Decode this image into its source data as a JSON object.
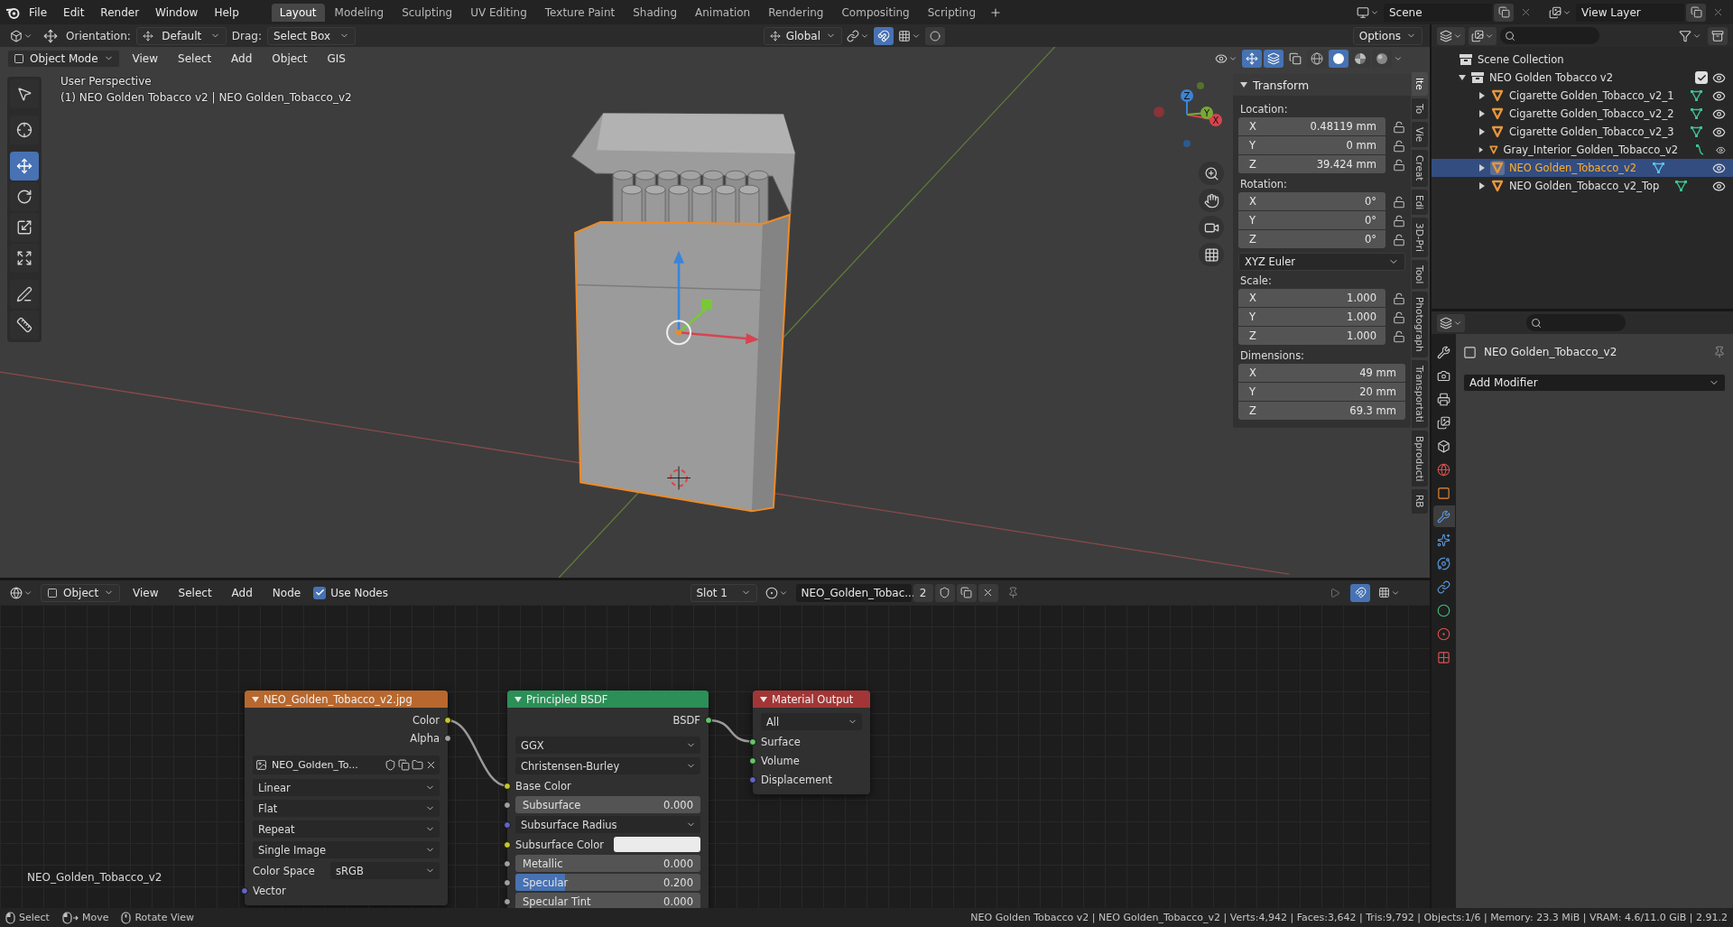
{
  "menu": [
    "File",
    "Edit",
    "Render",
    "Window",
    "Help"
  ],
  "workspaces": [
    {
      "label": "Layout",
      "selected": true
    },
    {
      "label": "Modeling",
      "selected": false
    },
    {
      "label": "Sculpting",
      "selected": false
    },
    {
      "label": "UV Editing",
      "selected": false
    },
    {
      "label": "Texture Paint",
      "selected": false
    },
    {
      "label": "Shading",
      "selected": false
    },
    {
      "label": "Animation",
      "selected": false
    },
    {
      "label": "Rendering",
      "selected": false
    },
    {
      "label": "Compositing",
      "selected": false
    },
    {
      "label": "Scripting",
      "selected": false
    }
  ],
  "scene": "Scene",
  "view_layer": "View Layer",
  "viewport": {
    "header": {
      "orientation_label": "Orientation:",
      "orientation": "Default",
      "drag_label": "Drag:",
      "drag": "Select Box",
      "transform_orientation": "Global",
      "options": "Options"
    },
    "mode": "Object Mode",
    "menus": [
      "View",
      "Select",
      "Add",
      "Object",
      "GIS"
    ],
    "shading": [
      {
        "kind": "wireframe",
        "selected": false
      },
      {
        "kind": "solid",
        "selected": true
      },
      {
        "kind": "material",
        "selected": false
      },
      {
        "kind": "rendered",
        "selected": false
      }
    ],
    "info": [
      "User Perspective",
      "(1) NEO Golden Tobacco v2 | NEO Golden_Tobacco_v2"
    ],
    "tools": [
      {
        "kind": "select",
        "selected": false
      },
      {
        "kind": "cursor",
        "selected": false
      },
      {
        "kind": "move",
        "selected": true
      },
      {
        "kind": "rotate",
        "selected": false
      },
      {
        "kind": "scale",
        "selected": false
      },
      {
        "kind": "transform",
        "selected": false
      },
      {
        "kind": "annotate",
        "selected": false
      },
      {
        "kind": "measure",
        "selected": false
      }
    ],
    "gizmo_axes": [
      {
        "label": "X",
        "color": "#d8434f"
      },
      {
        "label": "Y",
        "color": "#79a937"
      },
      {
        "label": "Z",
        "color": "#3a84d8"
      }
    ],
    "sidebar_tabs": [
      {
        "label": "Ite",
        "selected": true
      },
      {
        "label": "To",
        "selected": false
      },
      {
        "label": "Vie",
        "selected": false
      },
      {
        "label": "Creat",
        "selected": false
      },
      {
        "label": "Edi",
        "selected": false
      },
      {
        "label": "3D-Pri",
        "selected": false
      },
      {
        "label": "Tool",
        "selected": false
      },
      {
        "label": "Photograph",
        "selected": false
      },
      {
        "label": "Transportati",
        "selected": false
      },
      {
        "label": "Bproducti",
        "selected": false
      },
      {
        "label": "RB",
        "selected": false
      }
    ],
    "transform": {
      "title": "Transform",
      "groups": [
        {
          "label": "Location:",
          "locks": true,
          "fields": [
            {
              "axis": "X",
              "value": "0.48119 mm"
            },
            {
              "axis": "Y",
              "value": "0 mm"
            },
            {
              "axis": "Z",
              "value": "39.424 mm"
            }
          ]
        },
        {
          "label": "Rotation:",
          "locks": true,
          "fields": [
            {
              "axis": "X",
              "value": "0°"
            },
            {
              "axis": "Y",
              "value": "0°"
            },
            {
              "axis": "Z",
              "value": "0°"
            }
          ],
          "mode": "XYZ Euler"
        },
        {
          "label": "Scale:",
          "locks": true,
          "fields": [
            {
              "axis": "X",
              "value": "1.000"
            },
            {
              "axis": "Y",
              "value": "1.000"
            },
            {
              "axis": "Z",
              "value": "1.000"
            }
          ]
        },
        {
          "label": "Dimensions:",
          "locks": false,
          "fields": [
            {
              "axis": "X",
              "value": "49 mm"
            },
            {
              "axis": "Y",
              "value": "20 mm"
            },
            {
              "axis": "Z",
              "value": "69.3 mm"
            }
          ]
        }
      ]
    }
  },
  "outliner": {
    "root": "Scene Collection",
    "collection": {
      "label": "NEO Golden Tobacco v2",
      "expanded": true,
      "checked": true,
      "visible": true,
      "children": [
        {
          "label": "Cigarette Golden_Tobacco_v2_1",
          "kind": "mesh",
          "selected": false,
          "expanded": false,
          "visible": true
        },
        {
          "label": "Cigarette Golden_Tobacco_v2_2",
          "kind": "mesh",
          "selected": false,
          "expanded": false,
          "visible": true
        },
        {
          "label": "Cigarette Golden_Tobacco_v2_3",
          "kind": "mesh",
          "selected": false,
          "expanded": false,
          "visible": true
        },
        {
          "label": "Gray_Interior_Golden_Tobacco_v2",
          "kind": "curve",
          "selected": false,
          "expanded": false,
          "visible": true
        },
        {
          "label": "NEO Golden_Tobacco_v2",
          "kind": "mesh",
          "selected": true,
          "expanded": false,
          "visible": true
        },
        {
          "label": "NEO Golden_Tobacco_v2_Top",
          "kind": "mesh",
          "selected": false,
          "expanded": false,
          "visible": true
        }
      ]
    }
  },
  "properties": {
    "tabs": [
      {
        "kind": "tool",
        "selected": false
      },
      {
        "kind": "render",
        "selected": false
      },
      {
        "kind": "output",
        "selected": false
      },
      {
        "kind": "view_layer",
        "selected": false
      },
      {
        "kind": "scene",
        "selected": false
      },
      {
        "kind": "world",
        "selected": false
      },
      {
        "kind": "object",
        "selected": false
      },
      {
        "kind": "modifier",
        "selected": true
      },
      {
        "kind": "particles",
        "selected": false
      },
      {
        "kind": "physics",
        "selected": false
      },
      {
        "kind": "constraints",
        "selected": false
      },
      {
        "kind": "data",
        "selected": false
      },
      {
        "kind": "material",
        "selected": false
      },
      {
        "kind": "texture",
        "selected": false
      }
    ],
    "object": "NEO Golden_Tobacco_v2",
    "add_modifier": "Add Modifier"
  },
  "node_editor": {
    "header": {
      "object": "Object",
      "menus": [
        "View",
        "Select",
        "Add",
        "Node"
      ],
      "use_nodes": {
        "label": "Use Nodes",
        "checked": true
      },
      "slot": "Slot 1",
      "material": "NEO_Golden_Tobac...",
      "users": "2"
    },
    "material_label": "NEO_Golden_Tobacco_v2",
    "nodes": [
      {
        "kind": "texture",
        "title": "NEO_Golden_Tobacco_v2.jpg",
        "rows": [
          {
            "kind": "output",
            "label": "Color",
            "socket": {
              "kind": "color"
            }
          },
          {
            "kind": "output",
            "label": "Alpha",
            "socket": {
              "kind": "float"
            }
          },
          {
            "kind": "image",
            "value": "NEO_Golden_To..."
          },
          {
            "kind": "dropdown",
            "value": "Linear"
          },
          {
            "kind": "dropdown",
            "value": "Flat"
          },
          {
            "kind": "dropdown",
            "value": "Repeat"
          },
          {
            "kind": "dropdown",
            "value": "Single Image"
          },
          {
            "kind": "property",
            "label": "Color Space",
            "value": "sRGB"
          },
          {
            "kind": "input",
            "label": "Vector",
            "socket": {
              "kind": "vector"
            }
          }
        ]
      },
      {
        "kind": "shader",
        "title": "Principled BSDF",
        "rows": [
          {
            "kind": "output",
            "label": "BSDF",
            "socket": {
              "kind": "shader"
            }
          },
          {
            "kind": "dropdown",
            "value": "GGX"
          },
          {
            "kind": "dropdown",
            "value": "Christensen-Burley"
          },
          {
            "kind": "input",
            "label": "Base Color",
            "socket": {
              "kind": "color"
            }
          },
          {
            "kind": "value",
            "label": "Subsurface",
            "value": "0.000",
            "level": 0,
            "socket": {
              "kind": "float"
            }
          },
          {
            "kind": "dropdown",
            "value": "Subsurface Radius",
            "socket": {
              "kind": "vector"
            }
          },
          {
            "kind": "color",
            "label": "Subsurface Color",
            "color": "#ebebeb",
            "socket": {
              "kind": "color"
            }
          },
          {
            "kind": "value",
            "label": "Metallic",
            "value": "0.000",
            "level": 0,
            "socket": {
              "kind": "float"
            }
          },
          {
            "kind": "value",
            "label": "Specular",
            "value": "0.200",
            "level": 0.27,
            "socket": {
              "kind": "float"
            }
          },
          {
            "kind": "value",
            "label": "Specular Tint",
            "value": "0.000",
            "level": 0,
            "socket": {
              "kind": "float"
            }
          }
        ]
      },
      {
        "kind": "output",
        "title": "Material Output",
        "rows": [
          {
            "kind": "dropdown",
            "value": "All"
          },
          {
            "kind": "input",
            "label": "Surface",
            "socket": {
              "kind": "shader"
            }
          },
          {
            "kind": "input",
            "label": "Volume",
            "socket": {
              "kind": "shader"
            }
          },
          {
            "kind": "input",
            "label": "Displacement",
            "socket": {
              "kind": "vector"
            }
          }
        ]
      }
    ]
  },
  "status": {
    "hints": [
      {
        "kind": "left",
        "label": "Select"
      },
      {
        "kind": "drag",
        "label": "Move"
      },
      {
        "kind": "middle",
        "label": "Rotate View"
      }
    ],
    "stats": "NEO Golden Tobacco v2 | NEO Golden_Tobacco_v2 | Verts:4,942 | Faces:3,642 | Tris:9,792 | Objects:1/6 | Memory: 23.3 MiB | VRAM: 4.6/11.0 GiB | 2.91.2"
  }
}
